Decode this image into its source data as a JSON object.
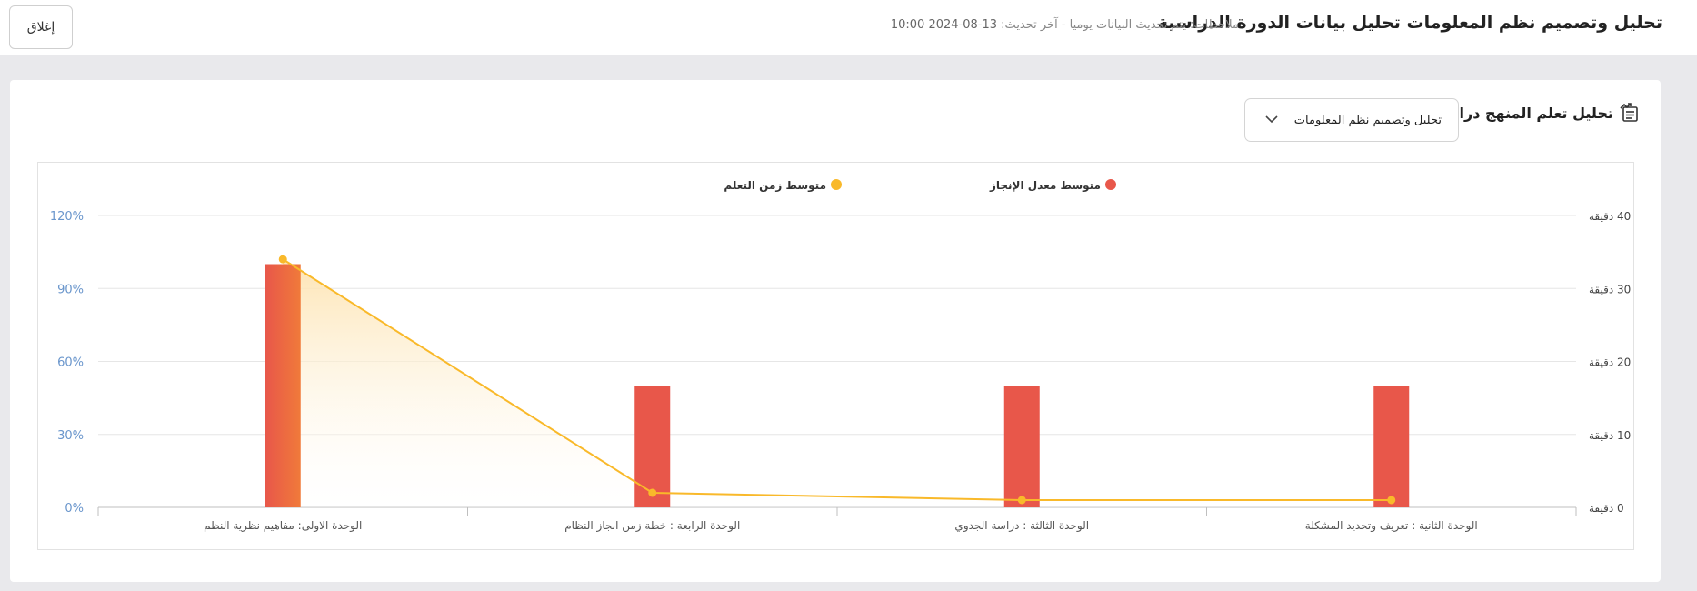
{
  "header": {
    "title": "تحليل وتصميم نظم المعلومات تحليل بيانات الدورة الدراسية",
    "notes_label": "ملاحظات: يتم تحديث البيانات يوميا - آخر تحديث:",
    "last_update": "13-08-2024 10:00",
    "close_label": "إغلاق"
  },
  "card": {
    "title": "تحليل تعلم المنهج دراسي",
    "select_value": "تحليل وتصميم نظم المعلومات"
  },
  "colors": {
    "bar": "#e8574a",
    "bar_highlight": "#f07a3a",
    "line": "#f9b92a",
    "area_top": "#fde3b0",
    "left_axis_text": "#6a96cc",
    "right_axis_text": "#444444",
    "grid": "#e6e6e6"
  },
  "chart_data": {
    "type": "bar",
    "categories": [
      "الوحدة الاولى: مفاهيم نظرية النظم",
      "الوحدة الرابعة : خطة زمن انجاز النظام",
      "الوحدة الثالثة : دراسة الجدوي",
      "الوحدة الثانية : تعريف وتحديد المشكلة"
    ],
    "series": [
      {
        "name": "متوسط معدل الإنجاز",
        "type": "bar",
        "axis": "left",
        "values": [
          100,
          50,
          50,
          50
        ]
      },
      {
        "name": "متوسط زمن التعلم",
        "type": "line",
        "axis": "right",
        "values": [
          34,
          2,
          1,
          1
        ]
      }
    ],
    "left_axis": {
      "ticks": [
        "0%",
        "30%",
        "60%",
        "90%",
        "120%"
      ],
      "min": 0,
      "max": 120
    },
    "right_axis": {
      "ticks": [
        "0 دقيقة",
        "10 دقيقة",
        "20 دقيقة",
        "30 دقيقة",
        "40 دقيقة"
      ],
      "min": 0,
      "max": 40
    },
    "legend_position": "top-center",
    "grid": true
  }
}
